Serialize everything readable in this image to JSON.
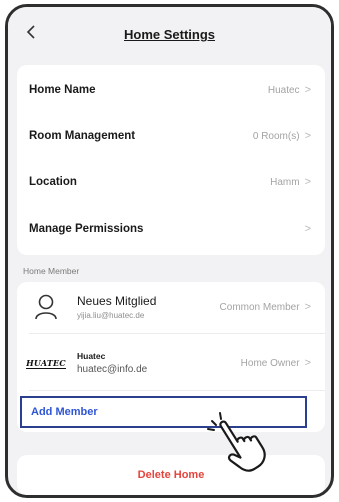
{
  "header": {
    "title": "Home Settings",
    "back_icon": "chevron-left-icon"
  },
  "settings": [
    {
      "label": "Home Name",
      "value": "Huatec"
    },
    {
      "label": "Room Management",
      "value": "0 Room(s)"
    },
    {
      "label": "Location",
      "value": "Hamm"
    },
    {
      "label": "Manage Permissions",
      "value": ""
    }
  ],
  "members_section_label": "Home Member",
  "members": [
    {
      "name": "Neues Mitglied",
      "email": "yijia.liu@huatec.de",
      "role": "Common Member",
      "avatar": "person-icon"
    },
    {
      "name": "Huatec",
      "email": "huatec@info.de",
      "role": "Home Owner",
      "avatar": "huatec-logo",
      "logo_text": "HUATEC"
    }
  ],
  "add_member_label": "Add Member",
  "delete_label": "Delete Home",
  "chevron_glyph": ">",
  "colors": {
    "accent": "#2f55d4",
    "highlight_border": "#2b3f8f",
    "danger": "#e5443c",
    "background": "#f2f2f4"
  }
}
